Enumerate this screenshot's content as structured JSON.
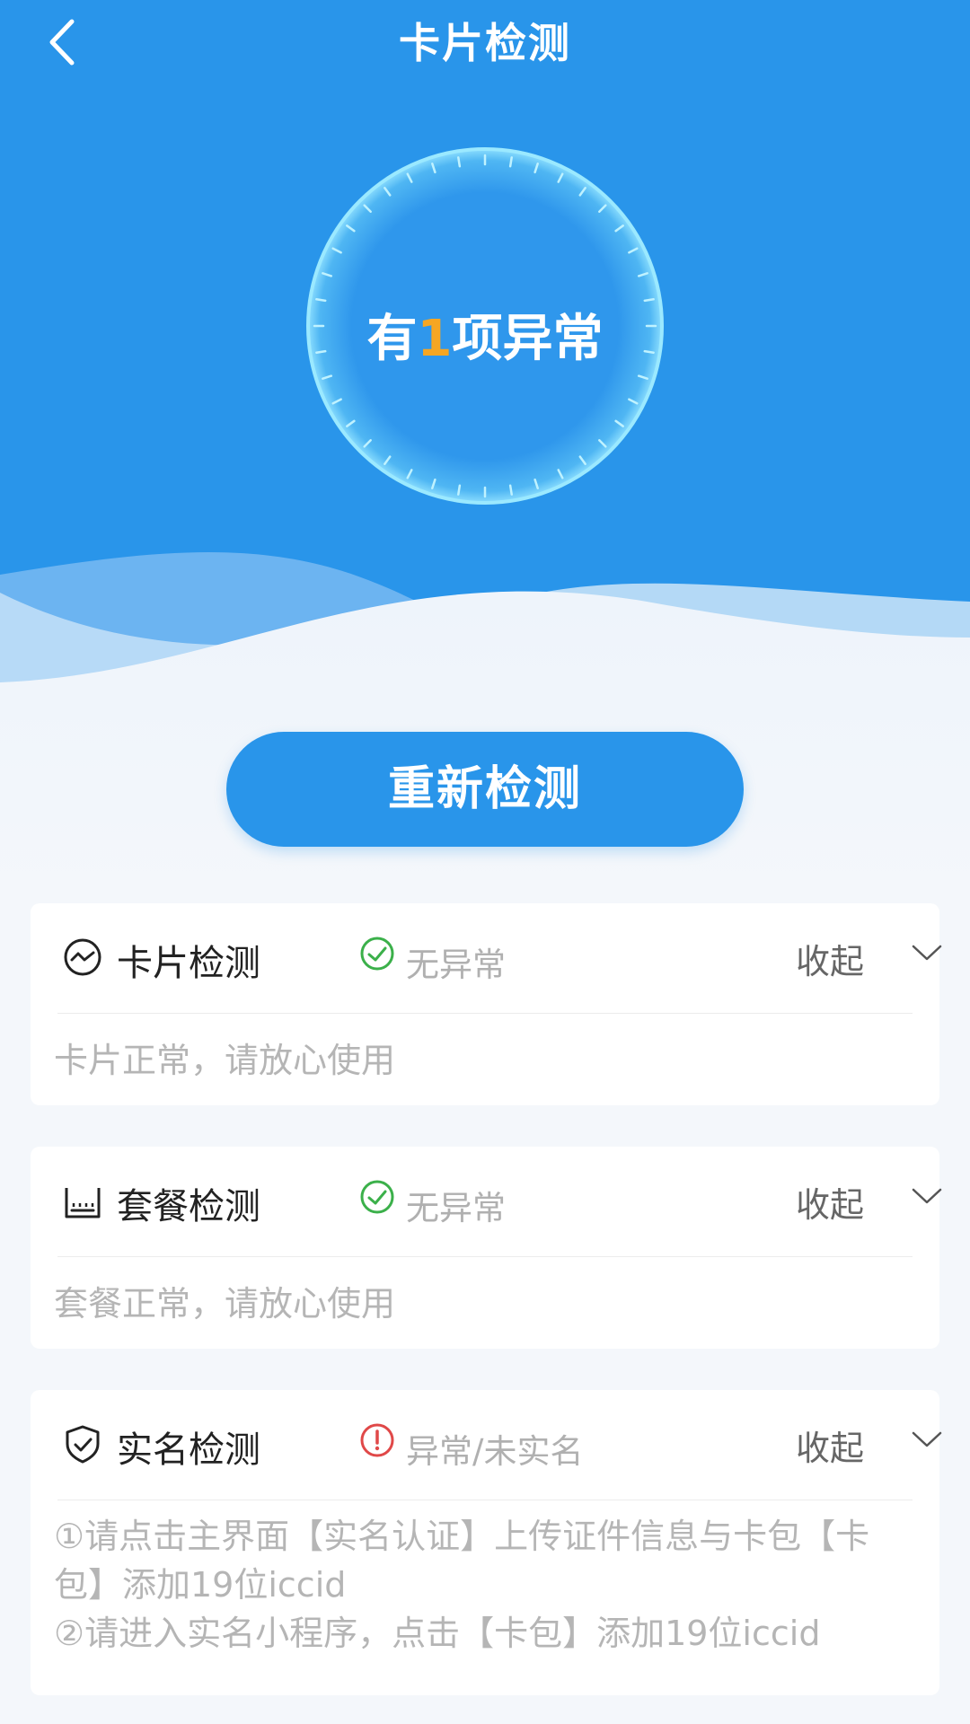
{
  "header": {
    "title": "卡片检测",
    "back_icon": "back-arrow-icon"
  },
  "summary": {
    "prefix": "有",
    "count": "1",
    "suffix": "项异常"
  },
  "actions": {
    "rescan_label": "重新检测"
  },
  "cards": [
    {
      "icon": "card-chip-icon",
      "title": "卡片检测",
      "status_icon": "check-circle-icon",
      "status": "无异常",
      "status_color": "#3bb04a",
      "collapse_label": "收起",
      "lines": [
        "卡片正常，请放心使用"
      ]
    },
    {
      "icon": "package-icon",
      "title": "套餐检测",
      "status_icon": "check-circle-icon",
      "status": "无异常",
      "status_color": "#3bb04a",
      "collapse_label": "收起",
      "lines": [
        "套餐正常，请放心使用"
      ]
    },
    {
      "icon": "shield-check-icon",
      "title": "实名检测",
      "status_icon": "warning-circle-icon",
      "status": "异常/未实名",
      "status_color": "#e04848",
      "collapse_label": "收起",
      "lines": [
        "①请点击主界面【实名认证】上传证件信息与卡包【卡",
        "包】添加19位iccid",
        "②请进入实名小程序，点击【卡包】添加19位iccid"
      ]
    }
  ],
  "colors": {
    "primary": "#2995ea",
    "highlight": "#f6a623",
    "ok": "#3bb04a",
    "error": "#e04848"
  }
}
